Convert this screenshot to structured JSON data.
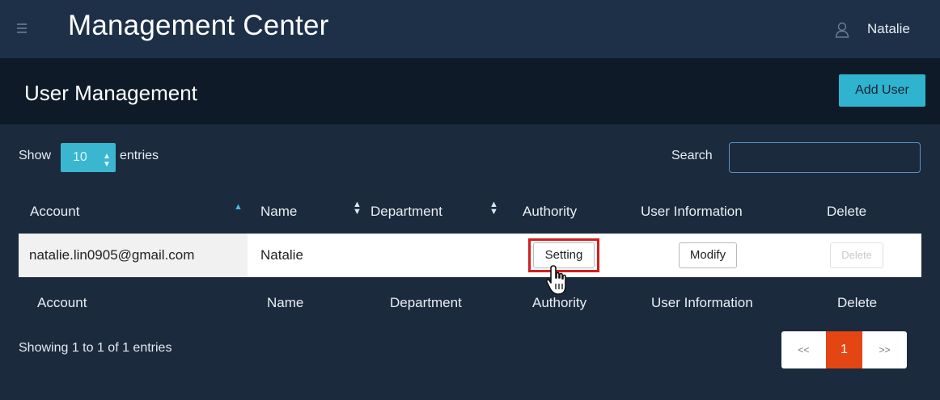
{
  "app": {
    "title": "Management Center",
    "user": "Natalie"
  },
  "header": {
    "title": "User Management",
    "add_user": "Add User"
  },
  "controls": {
    "show": "Show",
    "entries_value": "10",
    "entries": "entries",
    "search_label": "Search",
    "search_value": ""
  },
  "table": {
    "columns": [
      "Account",
      "Name",
      "Department",
      "Authority",
      "User Information",
      "Delete"
    ],
    "rows": [
      {
        "account": "natalie.lin0905@gmail.com",
        "name": "Natalie",
        "department": "",
        "authority_btn": "Setting",
        "info_btn": "Modify",
        "delete_btn": "Delete"
      }
    ]
  },
  "footer": {
    "info": "Showing 1 to 1 of 1 entries"
  },
  "pagination": {
    "prev": "<<",
    "current": "1",
    "next": ">>"
  },
  "colors": {
    "accent": "#2fb3ce",
    "highlight": "#d11f1f",
    "active_page": "#e44613"
  }
}
